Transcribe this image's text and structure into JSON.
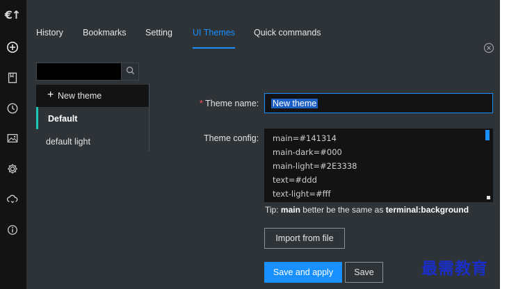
{
  "sidebar": {
    "logo": "€↑",
    "icons": [
      "add-circle-icon",
      "bookmark-icon",
      "history-clock-icon",
      "image-icon",
      "gear-icon",
      "cloud-sync-icon",
      "info-icon"
    ]
  },
  "tabs": [
    {
      "label": "History"
    },
    {
      "label": "Bookmarks"
    },
    {
      "label": "Setting"
    },
    {
      "label": "UI Themes"
    },
    {
      "label": "Quick commands"
    }
  ],
  "active_tab": "UI Themes",
  "theme_list": {
    "search_value": "",
    "new_theme_label": "New theme",
    "items": [
      {
        "label": "Default",
        "selected": true
      },
      {
        "label": "default light",
        "selected": false
      }
    ]
  },
  "form": {
    "required_mark": "*",
    "theme_name_label": "Theme name:",
    "theme_name_value": "New theme",
    "theme_config_label": "Theme config:",
    "config_lines": [
      "main=#141314",
      "main-dark=#000",
      "main-light=#2E3338",
      "text=#ddd",
      "text-light=#fff"
    ],
    "tip": {
      "prefix": "Tip:",
      "strong1": "main",
      "middle": "better be the same as",
      "strong2": "terminal:background"
    },
    "import_button": "Import from file",
    "save_apply_button": "Save and apply",
    "save_button": "Save"
  },
  "watermark": "最需教育",
  "colors": {
    "accent": "#1890ff",
    "sidebar_bg": "#141314",
    "panel_bg": "#2e3338",
    "selected_indicator": "#1ec8b4",
    "required": "#ff4d4f"
  }
}
